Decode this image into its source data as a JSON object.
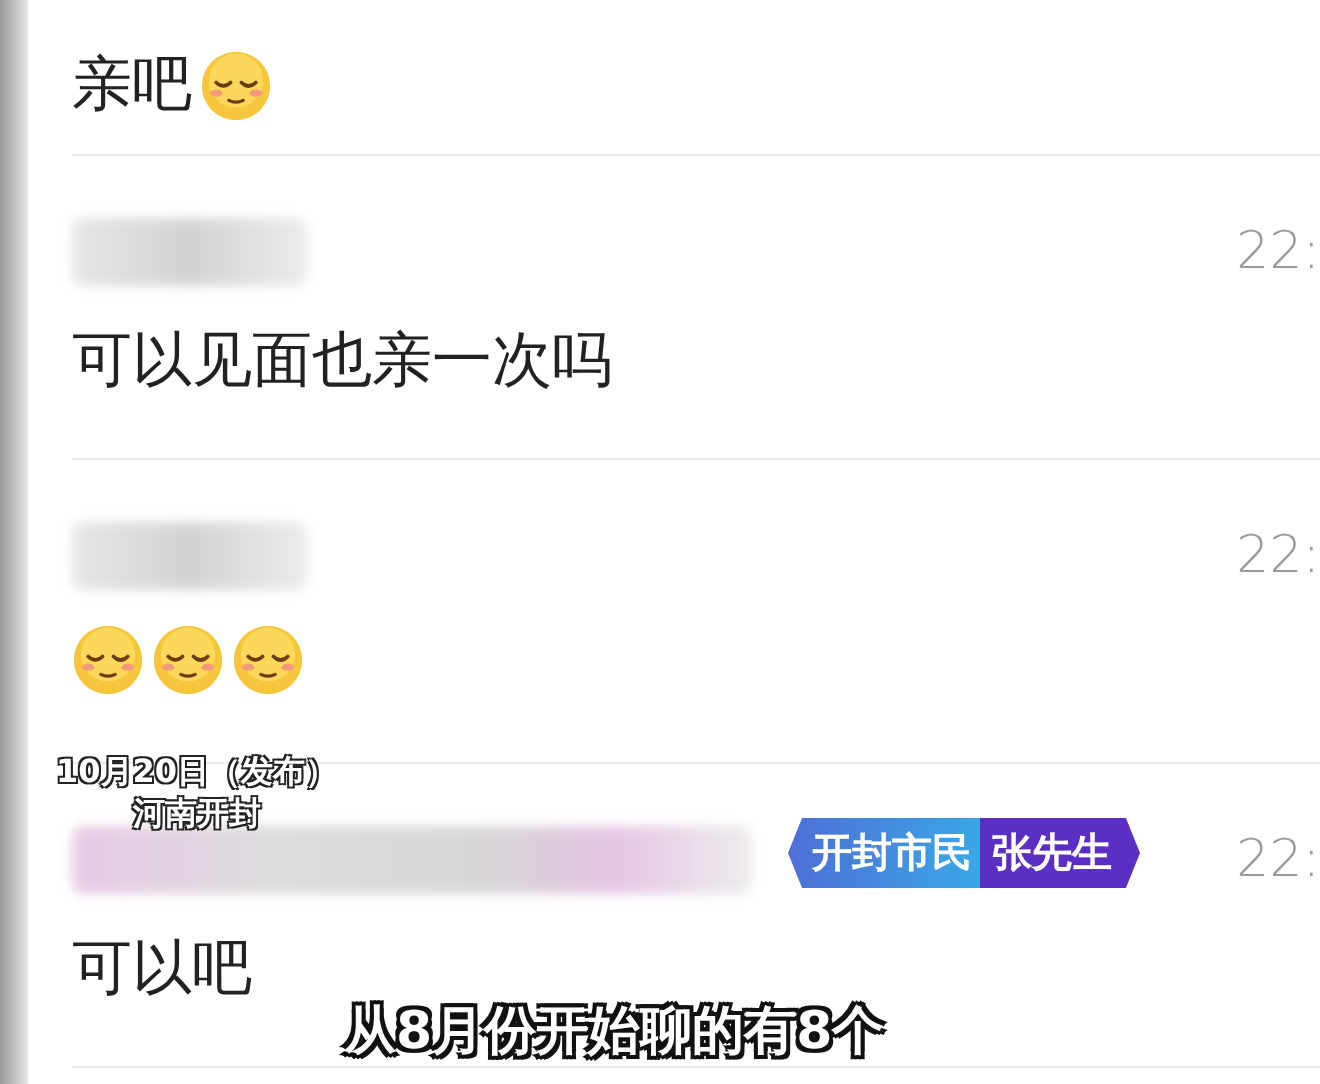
{
  "messages": [
    {
      "parts": [
        {
          "kind": "text",
          "text": "亲吧"
        },
        {
          "kind": "emoji"
        }
      ]
    },
    {
      "time": "22:",
      "parts": [
        {
          "kind": "text",
          "text": "可以见面也亲一次吗"
        }
      ]
    },
    {
      "time": "22:",
      "parts": [
        {
          "kind": "emoji"
        },
        {
          "kind": "emoji"
        },
        {
          "kind": "emoji"
        }
      ]
    },
    {
      "time": "22:",
      "parts": [
        {
          "kind": "text",
          "text": "可以吧"
        }
      ]
    }
  ],
  "overlay": {
    "date": "10月20日（发布）",
    "place": "河南开封",
    "speaker_place": "开封市民",
    "speaker_name": "张先生",
    "subtitle": "从8月份开始聊的有8个"
  }
}
